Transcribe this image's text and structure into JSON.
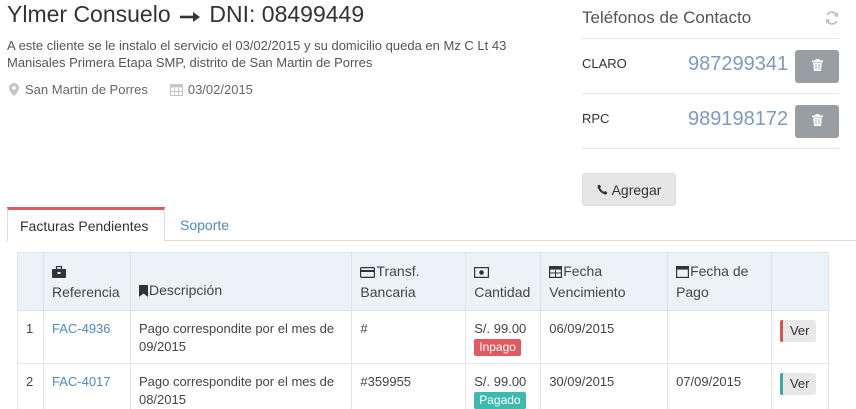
{
  "client": {
    "name": "Ylmer Consuelo",
    "dni": "DNI: 08499449",
    "description": "A este cliente se le instalo el servicio el 03/02/2015 y su domicilio queda en Mz C Lt 43 Manisales Primera Etapa SMP, distrito de San Martin de Porres",
    "district": "San Martin de Porres",
    "install_date": "03/02/2015"
  },
  "phones": {
    "title": "Teléfonos de Contacto",
    "items": [
      {
        "label": "CLARO",
        "number": "987299341"
      },
      {
        "label": "RPC",
        "number": "989198172"
      }
    ],
    "add_label": "Agregar"
  },
  "tabs": [
    {
      "label": "Facturas Pendientes",
      "active": true
    },
    {
      "label": "Soporte",
      "active": false
    }
  ],
  "table": {
    "headers": {
      "referencia": "Referencia",
      "descripcion": "Descripción",
      "transf_1": "Transf.",
      "transf_2": "Bancaria",
      "cantidad": "Cantidad",
      "fecha_venc_1": "Fecha",
      "fecha_venc_2": "Vencimiento",
      "fecha_pago_1": "Fecha de",
      "fecha_pago_2": "Pago"
    },
    "rows": [
      {
        "num": "1",
        "ref": "FAC-4936",
        "desc": "Pago correspondite por el mes de 09/2015",
        "transf": "#",
        "amount": "S/. 99.00",
        "status": "Inpago",
        "status_color": "#e05a5f",
        "due": "06/09/2015",
        "paid": "",
        "action": "Ver",
        "action_accent": "#d9534f"
      },
      {
        "num": "2",
        "ref": "FAC-4017",
        "desc": "Pago correspondite por el mes de 08/2015",
        "transf": "#359955",
        "amount": "S/. 99.00",
        "status": "Pagado",
        "status_color": "#3dbab0",
        "due": "30/09/2015",
        "paid": "07/09/2015",
        "action": "Ver",
        "action_accent": "#3aa99f"
      }
    ]
  }
}
